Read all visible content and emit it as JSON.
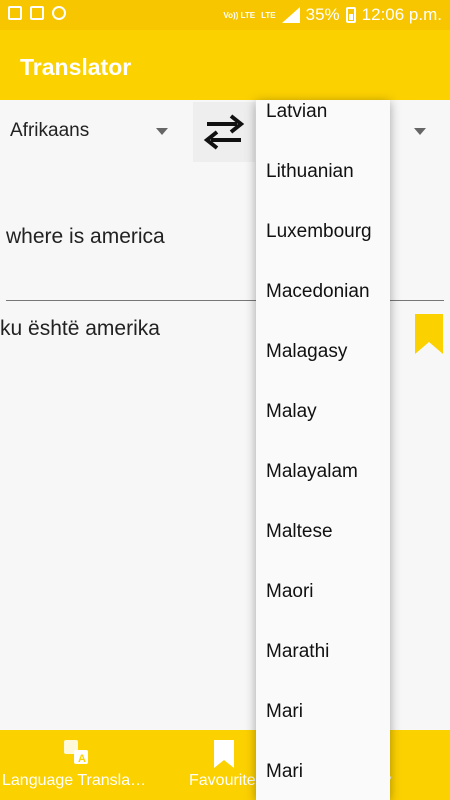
{
  "status_bar": {
    "volte_label": "Vo)) LTE",
    "lte_label": "LTE",
    "battery_percent": "35%",
    "time": "12:06 p.m."
  },
  "app": {
    "title": "Translator"
  },
  "language_bar": {
    "source_language": "Afrikaans"
  },
  "translation": {
    "input_text": "where is america",
    "output_text": "ku është amerika"
  },
  "dropdown": {
    "items": [
      "Latvian",
      "Lithuanian",
      "Luxembourg",
      "Macedonian",
      "Malagasy",
      "Malay",
      "Malayalam",
      "Maltese",
      "Maori",
      "Marathi",
      "Mari",
      "Mari"
    ]
  },
  "bottom_nav": {
    "translator_label": "Language Transla…",
    "favourites_label": "Favourites",
    "history_label": "ry"
  },
  "colors": {
    "accent": "#fcd100",
    "status_bar": "#f7c600"
  }
}
